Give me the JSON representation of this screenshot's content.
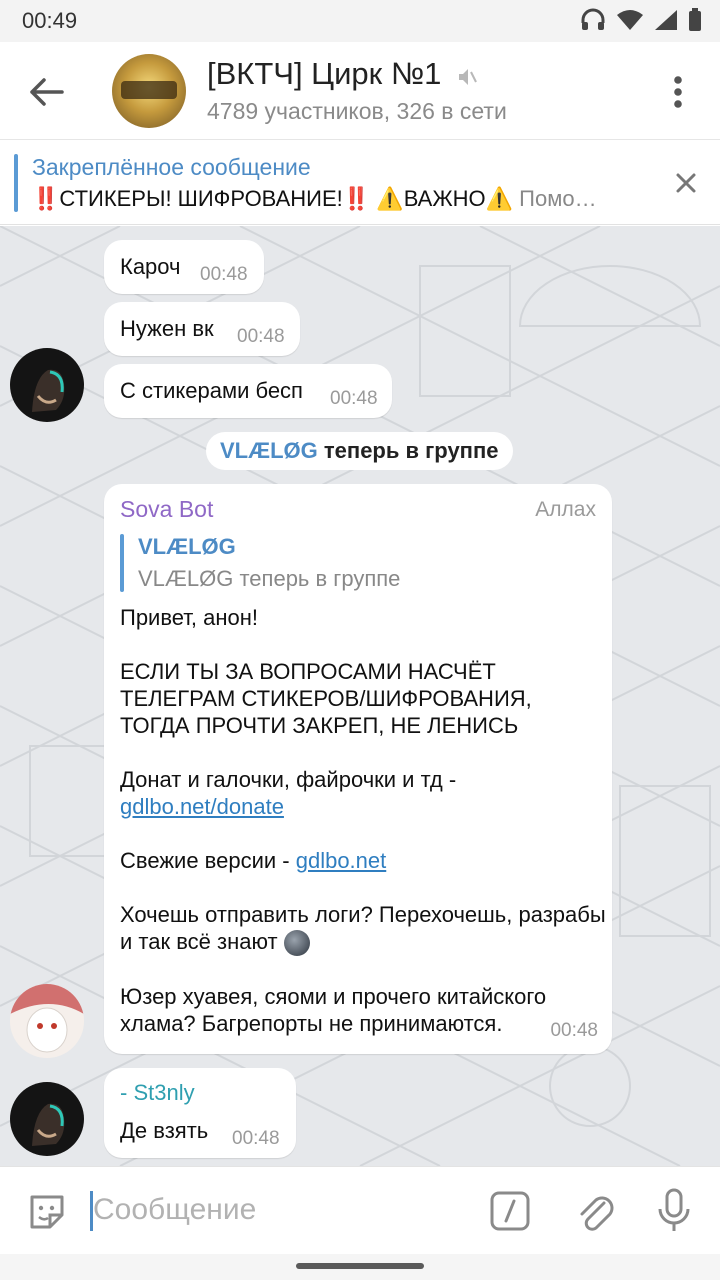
{
  "status": {
    "time": "00:49"
  },
  "header": {
    "title": "[ВКТЧ] Цирк №1",
    "subtitle": "4789 участников, 326 в сети"
  },
  "pinned": {
    "label": "Закреплённое сообщение",
    "part1": "‼️",
    "part2": "СТИКЕРЫ! ШИФРОВАНИЕ!",
    "part3": "‼️",
    "part4": " ⚠️",
    "part5": "ВАЖНО",
    "part6": "⚠️",
    "part7": "  Помо…"
  },
  "messages": [
    {
      "text": "Кароч",
      "time": "00:48"
    },
    {
      "text": "Нужен вк",
      "time": "00:48"
    },
    {
      "text": "С стикерами бесп",
      "time": "00:48"
    }
  ],
  "service": {
    "name": "VLÆLØG",
    "text": " теперь в группе"
  },
  "bot_message": {
    "sender": "Sova Bot",
    "badge": "Аллах",
    "reply_name": "VLÆLØG",
    "reply_text": "VLÆLØG теперь в группе",
    "p1": "Привет, анон!",
    "p2": "ЕСЛИ ТЫ ЗА ВОПРОСАМИ НАСЧЁТ ТЕЛЕГРАМ СТИКЕРОВ/ШИФРОВАНИЯ, ТОГДА ПРОЧТИ ЗАКРЕП, НЕ ЛЕНИСЬ",
    "p3_text": "Донат и галочки, файрочки и тд - ",
    "p3_link": "gdlbo.net/donate",
    "p4_text": "Свежие версии - ",
    "p4_link": "gdlbo.net",
    "p5_text": "Хочешь отправить логи? Перехочешь, разрабы и так всё знают ",
    "p6_text": "Юзер хуавея, сяоми и прочего китайского хлама? Багрепорты не принимаются.",
    "time": "00:48"
  },
  "last_message": {
    "sender": "- St3nly",
    "text": "Де взять",
    "time": "00:48"
  },
  "input": {
    "placeholder": "Сообщение"
  },
  "colors": {
    "accent": "#4d8bc5",
    "bot_name": "#8f68c6",
    "link": "#2f7ec0",
    "pin_red": "#d0281a"
  }
}
